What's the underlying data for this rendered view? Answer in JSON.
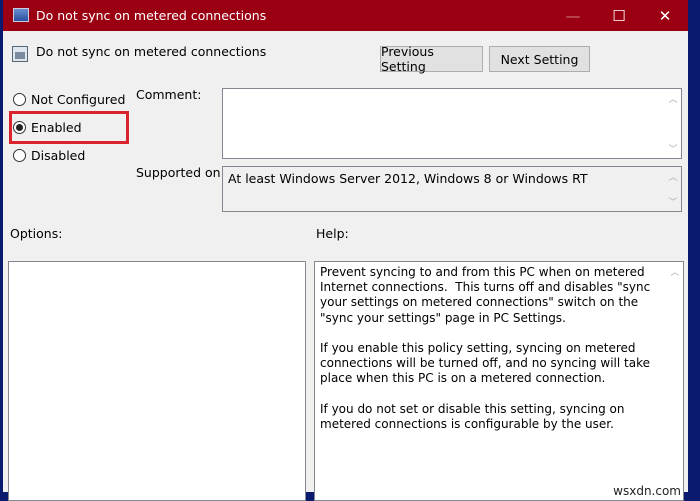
{
  "window": {
    "title": "Do not sync on metered connections"
  },
  "header": {
    "policy_name": "Do not sync on metered connections",
    "previous_label": "Previous Setting",
    "next_label": "Next Setting"
  },
  "state": {
    "options": [
      {
        "label": "Not Configured",
        "selected": false
      },
      {
        "label": "Enabled",
        "selected": true
      },
      {
        "label": "Disabled",
        "selected": false
      }
    ]
  },
  "comment": {
    "label": "Comment:",
    "value": ""
  },
  "supported": {
    "label": "Supported on:",
    "value": "At least Windows Server 2012, Windows 8 or Windows RT"
  },
  "options_label": "Options:",
  "help": {
    "label": "Help:",
    "text": "Prevent syncing to and from this PC when on metered Internet connections.  This turns off and disables \"sync your settings on metered connections\" switch on the \"sync your settings\" page in PC Settings.\n\nIf you enable this policy setting, syncing on metered connections will be turned off, and no syncing will take place when this PC is on a metered connection.\n\nIf you do not set or disable this setting, syncing on metered connections is configurable by the user."
  },
  "watermark": "wsxdn.com",
  "colors": {
    "titlebar": "#9b0012",
    "highlight": "#d9242b"
  }
}
